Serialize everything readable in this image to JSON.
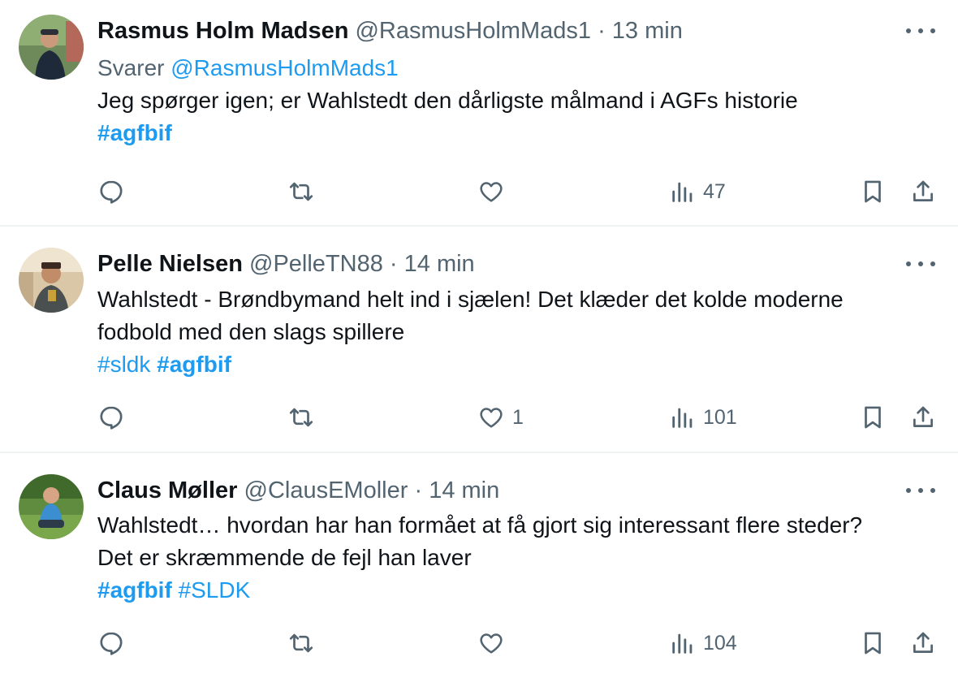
{
  "colors": {
    "link": "#1d9bf0",
    "secondary": "#536471",
    "text": "#0f1419",
    "divider": "#eff3f4"
  },
  "tweets": [
    {
      "name": "Rasmus Holm Madsen",
      "handle": "@RasmusHolmMads1",
      "sep": "·",
      "time": "13 min",
      "reply_label": "Svarer",
      "reply_handle": "@RasmusHolmMads1",
      "lines": [
        "Jeg spørger igen; er Wahlstedt den dårligste målmand i AGFs historie"
      ],
      "tags": [
        "#agfbif"
      ],
      "likes": "",
      "views": "47",
      "icons": {
        "reply": "reply-icon",
        "retweet": "retweet-icon",
        "like": "heart-icon",
        "views": "views-icon",
        "bookmark": "bookmark-icon",
        "share": "share-icon",
        "more": "more-icon"
      }
    },
    {
      "name": "Pelle Nielsen",
      "handle": "@PelleTN88",
      "sep": "·",
      "time": "14 min",
      "lines": [
        "Wahlstedt - Brøndbymand helt ind i sjælen! Det klæder det kolde moderne",
        "fodbold med den slags spillere"
      ],
      "tags": [
        "#sldk",
        "#agfbif"
      ],
      "likes": "1",
      "views": "101"
    },
    {
      "name": "Claus Møller",
      "handle": "@ClausEMoller",
      "sep": "·",
      "time": "14 min",
      "lines": [
        "Wahlstedt… hvordan har han formået at få gjort sig interessant flere steder?",
        "Det er skræmmende de fejl han laver"
      ],
      "tags": [
        "#agfbif",
        "#SLDK"
      ],
      "likes": "",
      "views": "104"
    }
  ]
}
